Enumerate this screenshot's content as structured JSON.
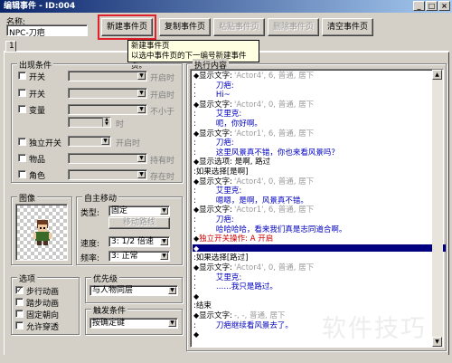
{
  "window": {
    "title": "编辑事件 - ID:004",
    "title_buttons": [
      "_",
      "□",
      "×"
    ]
  },
  "name": {
    "label": "名称:",
    "value": "NPC-刀疤"
  },
  "toolbar": {
    "new_page": "新建事件页",
    "copy_page": "复制事件页",
    "paste_page": "粘贴事件页",
    "delete_page": "删除事件页",
    "clear_page": "清空事件页"
  },
  "tooltip": {
    "line1": "新建事件页",
    "line2": "以选中事件页的下一编号新建事件页。"
  },
  "tabs": [
    "1"
  ],
  "conditions": {
    "title": "出现条件",
    "switch1": {
      "label": "开关",
      "suffix": "开启时"
    },
    "switch2": {
      "label": "开关",
      "suffix": "开启时"
    },
    "variable": {
      "label": "变量",
      "suffix": "不小于",
      "unit": "时"
    },
    "self_switch": {
      "label": "独立开关",
      "suffix": "开启时"
    },
    "item": {
      "label": "物品",
      "suffix": "持有时"
    },
    "actor": {
      "label": "角色",
      "suffix": "存在时"
    }
  },
  "image": {
    "title": "图像"
  },
  "autonomous": {
    "title": "自主移动",
    "type_label": "类型:",
    "type_value": "固定",
    "route_button": "移动路线",
    "speed_label": "速度:",
    "speed_value": "3: 1/2 倍速",
    "freq_label": "频率:",
    "freq_value": "3: 正常"
  },
  "options": {
    "title": "选项",
    "items": [
      {
        "label": "步行动画",
        "checked": true
      },
      {
        "label": "踏步动画",
        "checked": false
      },
      {
        "label": "固定朝向",
        "checked": false
      },
      {
        "label": "允许穿透",
        "checked": false
      }
    ]
  },
  "priority": {
    "title": "优先级",
    "value": "与人物同层"
  },
  "trigger": {
    "title": "触发条件",
    "value": "按确定键"
  },
  "contents": {
    "title": "执行内容",
    "lines": [
      {
        "diamond": "◆",
        "text": "显示文字:",
        "meta": "'Actor4', 6, 普通, 居下",
        "cls": ""
      },
      {
        "diamond": "",
        "text": "   :",
        "meta": "",
        "body": "刀疤:",
        "cls": ""
      },
      {
        "diamond": "",
        "text": "   :",
        "meta": "",
        "body": "Hi~",
        "cls": ""
      },
      {
        "diamond": "◆",
        "text": "显示文字:",
        "meta": "'Actor4', 0, 普通, 居下",
        "cls": ""
      },
      {
        "diamond": "",
        "text": "   :",
        "meta": "",
        "body": "艾里克:",
        "cls": ""
      },
      {
        "diamond": "",
        "text": "   :",
        "meta": "",
        "body": "呃，你好啊。",
        "cls": ""
      },
      {
        "diamond": "◆",
        "text": "显示文字:",
        "meta": "'Actor1', 6, 普通, 居下",
        "cls": ""
      },
      {
        "diamond": "",
        "text": "   :",
        "meta": "",
        "body": "刀疤:",
        "cls": ""
      },
      {
        "diamond": "",
        "text": "   :",
        "meta": "",
        "body": "这里风景真不错，你也来看风景吗？",
        "cls": ""
      },
      {
        "diamond": "◆",
        "text": "显示选项: 是啊, 路过",
        "meta": "",
        "cls": ""
      },
      {
        "diamond": "",
        "text": ":如果选择[是啊]",
        "meta": "",
        "cls": ""
      },
      {
        "diamond": "  ◆",
        "text": "显示文字:",
        "meta": "'Actor4', 0, 普通, 居下",
        "cls": ""
      },
      {
        "diamond": "",
        "text": "     :",
        "meta": "",
        "body": "艾里克:",
        "cls": ""
      },
      {
        "diamond": "",
        "text": "     :",
        "meta": "",
        "body": "嗯嗯，是啊，风景真不错。",
        "cls": ""
      },
      {
        "diamond": "  ◆",
        "text": "显示文字:",
        "meta": "'Actor1', 6, 普通, 居下",
        "cls": ""
      },
      {
        "diamond": "",
        "text": "     :",
        "meta": "",
        "body": "刀疤:",
        "cls": ""
      },
      {
        "diamond": "",
        "text": "     :",
        "meta": "",
        "body": "哈哈哈哈，看来我们真是志同道合啊。",
        "cls": ""
      },
      {
        "diamond": "  ◆",
        "text": "独立开关操作: A 开启",
        "meta": "",
        "cls": "red"
      },
      {
        "diamond": "  ◆",
        "text": "",
        "meta": "",
        "cls": "selected"
      },
      {
        "diamond": "",
        "text": ":如果选择[路过]",
        "meta": "",
        "cls": ""
      },
      {
        "diamond": "  ◆",
        "text": "显示文字:",
        "meta": "'Actor4', 0, 普通, 居下",
        "cls": ""
      },
      {
        "diamond": "",
        "text": "     :",
        "meta": "",
        "body": "艾里克:",
        "cls": ""
      },
      {
        "diamond": "",
        "text": "     :",
        "meta": "",
        "body": "……我只是路过。",
        "cls": ""
      },
      {
        "diamond": "  ◆",
        "text": "",
        "meta": "",
        "cls": ""
      },
      {
        "diamond": "",
        "text": ":结束",
        "meta": "",
        "cls": ""
      },
      {
        "diamond": "◆",
        "text": "显示文字:",
        "meta": "-, -, 普通, 居下",
        "cls": ""
      },
      {
        "diamond": "",
        "text": "   :",
        "meta": "",
        "body": "刀疤继续看风景去了。",
        "cls": ""
      },
      {
        "diamond": "◆",
        "text": "",
        "meta": "",
        "cls": ""
      }
    ]
  },
  "watermark": "软件技巧",
  "colors": {
    "highlight_box": "#e0202a",
    "selection": "#000080",
    "title_bar": "#0a246a"
  }
}
